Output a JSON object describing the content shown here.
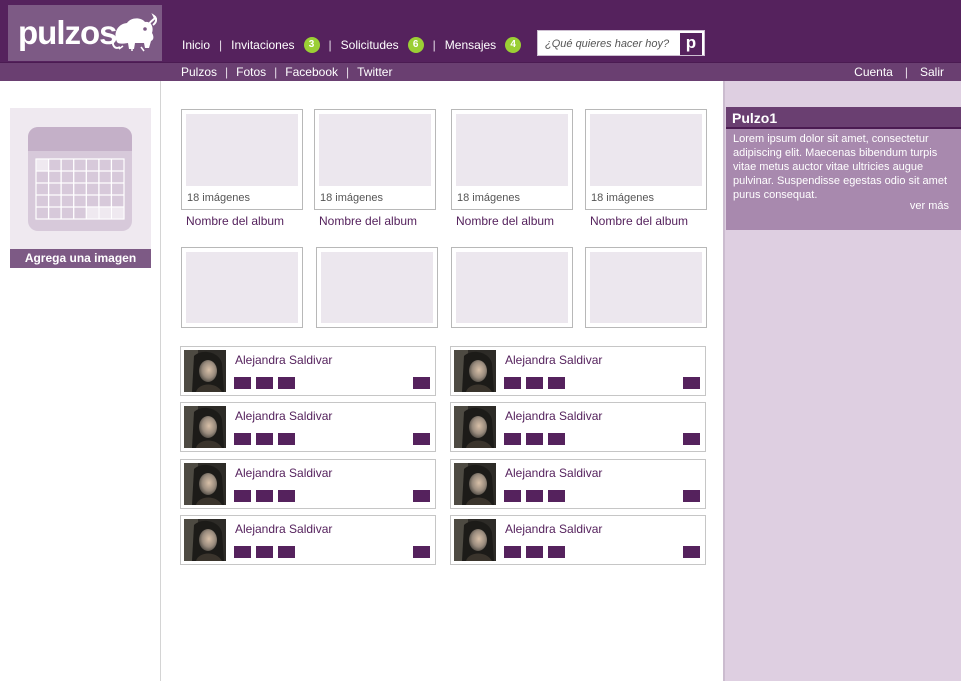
{
  "brand": {
    "logo_text": "pulzos",
    "logo_icon": "elephant-icon"
  },
  "colors": {
    "primary": "#55225d",
    "secondary": "#6a3f71",
    "accent": "#7d5a85",
    "badge": "#9bcf35",
    "panel": "#decfe1"
  },
  "main_nav": [
    {
      "label": "Inicio"
    },
    {
      "label": "Invitaciones",
      "badge": "3"
    },
    {
      "label": "Solicitudes",
      "badge": "6"
    },
    {
      "label": "Mensajes",
      "badge": "4"
    }
  ],
  "search": {
    "placeholder": "¿Qué quieres hacer hoy?",
    "button_icon": "p-logo-icon",
    "button_glyph": "p"
  },
  "sub_nav": [
    {
      "label": "Pulzos"
    },
    {
      "label": "Fotos"
    },
    {
      "label": "Facebook"
    },
    {
      "label": "Twitter"
    }
  ],
  "user_nav": [
    {
      "label": "Cuenta"
    },
    {
      "label": "Salir"
    }
  ],
  "upload": {
    "label": "Agrega una imagen",
    "icon": "calendar-icon"
  },
  "albums": [
    {
      "count": "18 imágenes",
      "title": "Nombre del album"
    },
    {
      "count": "18 imágenes",
      "title": "Nombre del album"
    },
    {
      "count": "18 imágenes",
      "title": "Nombre del album"
    },
    {
      "count": "18 imágenes",
      "title": "Nombre del album"
    }
  ],
  "friends": [
    {
      "name": "Alejandra Saldivar"
    },
    {
      "name": "Alejandra Saldivar"
    },
    {
      "name": "Alejandra Saldivar"
    },
    {
      "name": "Alejandra Saldivar"
    },
    {
      "name": "Alejandra Saldivar"
    },
    {
      "name": "Alejandra Saldivar"
    },
    {
      "name": "Alejandra Saldivar"
    },
    {
      "name": "Alejandra Saldivar"
    }
  ],
  "profile": {
    "name": "Pulzo1",
    "description": "Lorem ipsum dolor sit amet, consectetur adipiscing elit. Maecenas bibendum turpis vitae metus auctor vitae ultricies augue pulvinar. Suspendisse egestas odio sit amet purus consequat.",
    "more_label": "ver más"
  }
}
